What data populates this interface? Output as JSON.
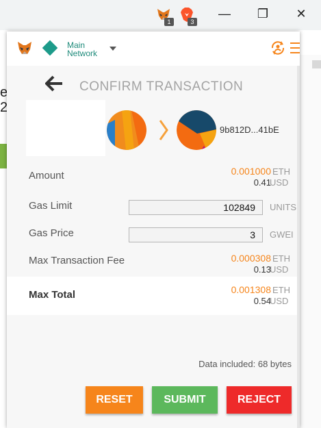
{
  "browser": {
    "extensions": [
      {
        "icon": "metamask-fox-icon",
        "badge": "1"
      },
      {
        "icon": "brave-lion-icon",
        "badge": "3"
      }
    ],
    "window_controls": {
      "minimize": "—",
      "restore": "❐",
      "close": "✕"
    }
  },
  "background_page": {
    "line1": "e",
    "line2": "2"
  },
  "header": {
    "network_line1": "Main",
    "network_line2": "Network",
    "network_color": "#1d9b8a",
    "accent_color": "#f6851b"
  },
  "confirm": {
    "title": "CONFIRM TRANSACTION",
    "to_address": "9b812D...41bE"
  },
  "details": {
    "amount": {
      "label": "Amount",
      "eth": "0.001000",
      "eth_unit": "ETH",
      "usd": "0.41",
      "usd_unit": "USD"
    },
    "gas_limit": {
      "label": "Gas Limit",
      "value": "102849",
      "unit": "UNITS"
    },
    "gas_price": {
      "label": "Gas Price",
      "value": "3",
      "unit": "GWEI"
    },
    "max_fee": {
      "label": "Max Transaction Fee",
      "eth": "0.000308",
      "eth_unit": "ETH",
      "usd": "0.13",
      "usd_unit": "USD"
    },
    "max_total": {
      "label": "Max Total",
      "eth": "0.001308",
      "eth_unit": "ETH",
      "usd": "0.54",
      "usd_unit": "USD"
    }
  },
  "data_included": "Data included: 68 bytes",
  "buttons": {
    "reset": {
      "label": "RESET",
      "color": "#f6851b"
    },
    "submit": {
      "label": "SUBMIT",
      "color": "#5cb85c"
    },
    "reject": {
      "label": "REJECT",
      "color": "#ee2a2a"
    }
  }
}
